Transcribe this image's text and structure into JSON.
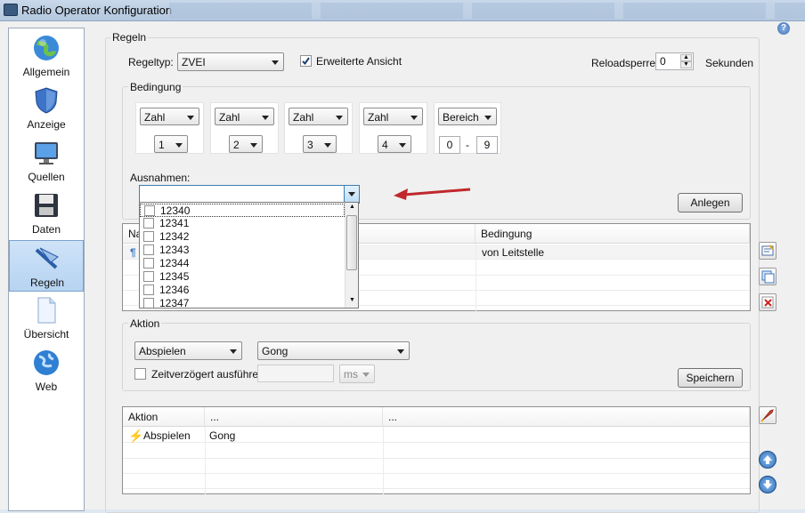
{
  "window": {
    "title": "Radio Operator Konfiguration"
  },
  "nav": {
    "items": [
      {
        "label": "Allgemein",
        "icon": "globe-icon"
      },
      {
        "label": "Anzeige",
        "icon": "shield-icon"
      },
      {
        "label": "Quellen",
        "icon": "monitor-icon"
      },
      {
        "label": "Daten",
        "icon": "floppy-disk-icon"
      },
      {
        "label": "Regeln",
        "icon": "pen-rule-icon",
        "active": true
      },
      {
        "label": "Übersicht",
        "icon": "document-icon"
      },
      {
        "label": "Web",
        "icon": "globe-web-icon"
      }
    ]
  },
  "regeln": {
    "group_label": "Regeln",
    "regeltyp_label": "Regeltyp:",
    "regeltyp_value": "ZVEI",
    "erweiterte_label": "Erweiterte Ansicht",
    "erweiterte_checked": true,
    "reload_label": "Reloadsperre:",
    "reload_value": "0",
    "reload_unit": "Sekunden"
  },
  "bedingung": {
    "group_label": "Bedingung",
    "boxes": [
      {
        "type": "Zahl",
        "value": "1"
      },
      {
        "type": "Zahl",
        "value": "2"
      },
      {
        "type": "Zahl",
        "value": "3"
      },
      {
        "type": "Zahl",
        "value": "4"
      }
    ],
    "bereich": {
      "type": "Bereich",
      "from": "0",
      "separator": "-",
      "to": "9"
    },
    "ausnahmen_label": "Ausnahmen:",
    "ausnahmen_value": "",
    "ausnahmen_options": [
      "12340",
      "12341",
      "12342",
      "12343",
      "12344",
      "12345",
      "12346",
      "12347"
    ],
    "anlegen_label": "Anlegen"
  },
  "rules_table": {
    "columns": [
      "Na",
      "Bedingung"
    ],
    "rows": [
      {
        "name": "",
        "bedingung": "von Leitstelle"
      }
    ]
  },
  "aktion": {
    "group_label": "Aktion",
    "action_value": "Abspielen",
    "sound_value": "Gong",
    "delay_label": "Zeitverzögert ausführen",
    "delay_checked": false,
    "delay_value": "",
    "delay_unit": "ms",
    "speichern_label": "Speichern"
  },
  "actions_table": {
    "columns": [
      "Aktion",
      "...",
      "..."
    ],
    "rows": [
      {
        "aktion": "Abspielen",
        "param": "Gong",
        "extra": ""
      }
    ]
  },
  "colors": {
    "accent": "#3b78c3",
    "arrow": "#c0282d",
    "selected": "#bcd6f2"
  }
}
